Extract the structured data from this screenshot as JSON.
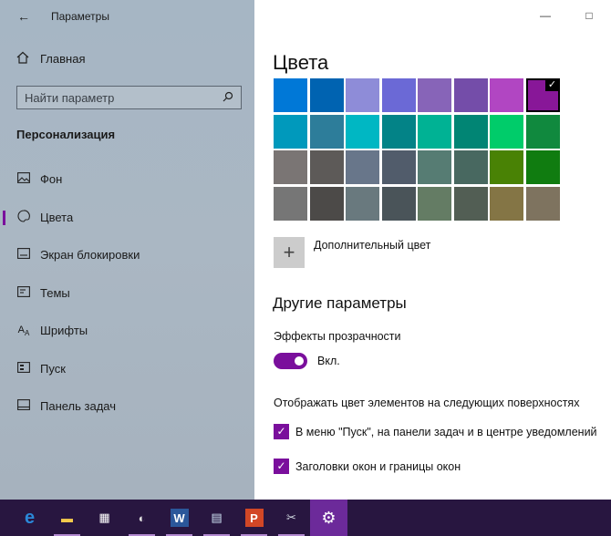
{
  "window": {
    "title": "Параметры",
    "caption_minimize": "—",
    "caption_close": "□"
  },
  "sidebar": {
    "back_icon": "back-arrow-icon",
    "home_label": "Главная",
    "search_placeholder": "Найти параметр",
    "section_title": "Персонализация",
    "items": [
      {
        "label": "Фон",
        "icon": "picture-icon",
        "active": false
      },
      {
        "label": "Цвета",
        "icon": "palette-icon",
        "active": true
      },
      {
        "label": "Экран блокировки",
        "icon": "lock-screen-icon",
        "active": false
      },
      {
        "label": "Темы",
        "icon": "themes-icon",
        "active": false
      },
      {
        "label": "Шрифты",
        "icon": "fonts-icon",
        "active": false
      },
      {
        "label": "Пуск",
        "icon": "start-icon",
        "active": false
      },
      {
        "label": "Панель задач",
        "icon": "taskbar-icon",
        "active": false
      }
    ]
  },
  "main": {
    "title": "Цвета",
    "palette": [
      "#0078d7",
      "#0063b1",
      "#8e8cd8",
      "#6b69d6",
      "#8764b8",
      "#744da9",
      "#b146c2",
      "#881798",
      "#0099bc",
      "#2d7d9a",
      "#00b7c3",
      "#038387",
      "#00b294",
      "#018574",
      "#00cc6a",
      "#10893e",
      "#7a7574",
      "#5d5a58",
      "#68768a",
      "#515c6b",
      "#567c73",
      "#486860",
      "#498205",
      "#107c10",
      "#767676",
      "#4c4a48",
      "#69797e",
      "#4a5459",
      "#647c64",
      "#525e54",
      "#847545",
      "#7e735f"
    ],
    "selected_color": "#881798",
    "custom_color_label": "Дополнительный цвет",
    "other_options_title": "Другие параметры",
    "transparency_label": "Эффекты прозрачности",
    "transparency_state": "Вкл.",
    "transparency_on": true,
    "surfaces_label": "Отображать цвет элементов на следующих поверхностях",
    "checkbox_start": "В меню \"Пуск\", на панели задач и в центре уведомлений",
    "checkbox_titlebars": "Заголовки окон и границы окон",
    "accent_color": "#7a0f9c"
  },
  "taskbar": {
    "items": [
      {
        "name": "edge-icon",
        "glyph": "e",
        "active": false,
        "running": false
      },
      {
        "name": "file-explorer-icon",
        "glyph": "▬",
        "active": false,
        "running": true
      },
      {
        "name": "store-icon",
        "glyph": "▦",
        "active": false,
        "running": false
      },
      {
        "name": "paint-icon",
        "glyph": "◐",
        "active": false,
        "running": true
      },
      {
        "name": "word-icon",
        "glyph": "W",
        "active": false,
        "running": true
      },
      {
        "name": "notepad-icon",
        "glyph": "▤",
        "active": false,
        "running": true
      },
      {
        "name": "powerpoint-icon",
        "glyph": "P",
        "active": false,
        "running": true
      },
      {
        "name": "snipping-tool-icon",
        "glyph": "✂",
        "active": false,
        "running": true
      },
      {
        "name": "settings-icon",
        "glyph": "⚙",
        "active": true,
        "running": true
      }
    ]
  }
}
